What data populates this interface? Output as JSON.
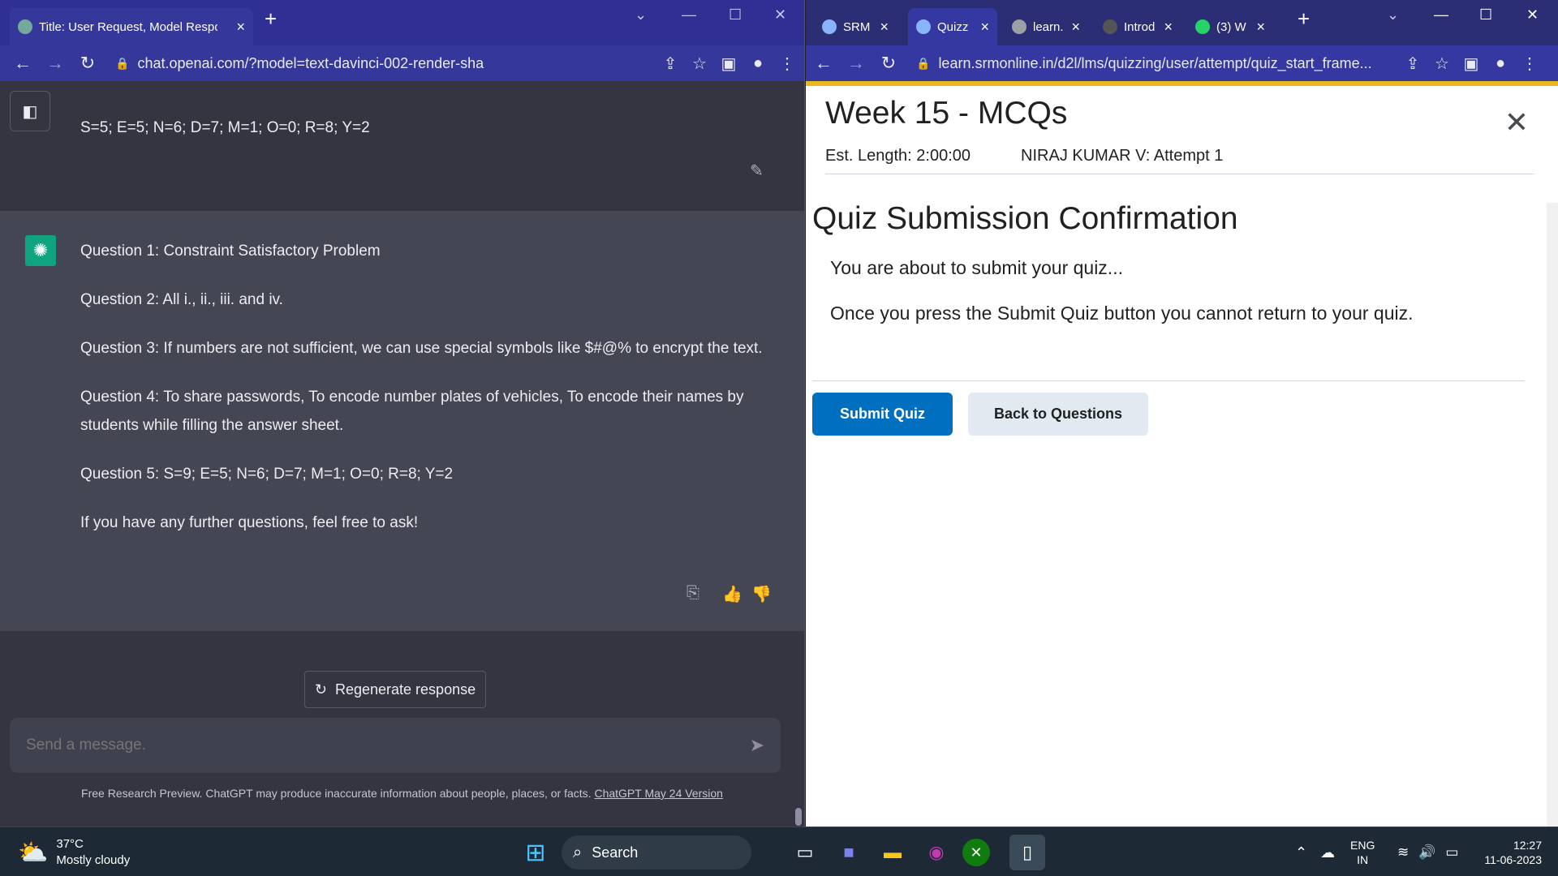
{
  "left_window": {
    "tab_title": "Title: User Request, Model Respo",
    "url": "chat.openai.com/?model=text-davinci-002-render-sha",
    "user_message": "S=5; E=5; N=6; D=7; M=1; O=0; R=8; Y=2",
    "assistant_lines": [
      "Question 1: Constraint Satisfactory Problem",
      "Question 2: All i., ii., iii. and iv.",
      "Question 3: If numbers are not sufficient, we can use special symbols like $#@% to encrypt the text.",
      "Question 4: To share passwords, To encode number plates of vehicles, To encode their names by students while filling the answer sheet.",
      "Question 5: S=9; E=5; N=6; D=7; M=1; O=0; R=8; Y=2",
      "If you have any further questions, feel free to ask!"
    ],
    "regenerate_label": "Regenerate response",
    "message_placeholder": "Send a message.",
    "footnote_text": "Free Research Preview. ChatGPT may produce inaccurate information about people, places, or facts.",
    "footnote_link": "ChatGPT May 24 Version"
  },
  "right_window": {
    "tabs": [
      {
        "label": "SRM"
      },
      {
        "label": "Quizz"
      },
      {
        "label": "learn."
      },
      {
        "label": "Introd"
      },
      {
        "label": "(3) W"
      }
    ],
    "url": "learn.srmonline.in/d2l/lms/quizzing/user/attempt/quiz_start_frame...",
    "quiz_title": "Week 15 - MCQs",
    "est_length": "Est. Length: 2:00:00",
    "attempt": "NIRAJ KUMAR V: Attempt 1",
    "confirmation_title": "Quiz Submission Confirmation",
    "line1": "You are about to submit your quiz...",
    "line2": "Once you press the Submit Quiz button you cannot return to your quiz.",
    "submit_label": "Submit Quiz",
    "back_label": "Back to Questions"
  },
  "taskbar": {
    "temperature": "37°C",
    "weather": "Mostly cloudy",
    "search_label": "Search",
    "lang1": "ENG",
    "lang2": "IN",
    "time": "12:27",
    "date": "11-06-2023"
  }
}
